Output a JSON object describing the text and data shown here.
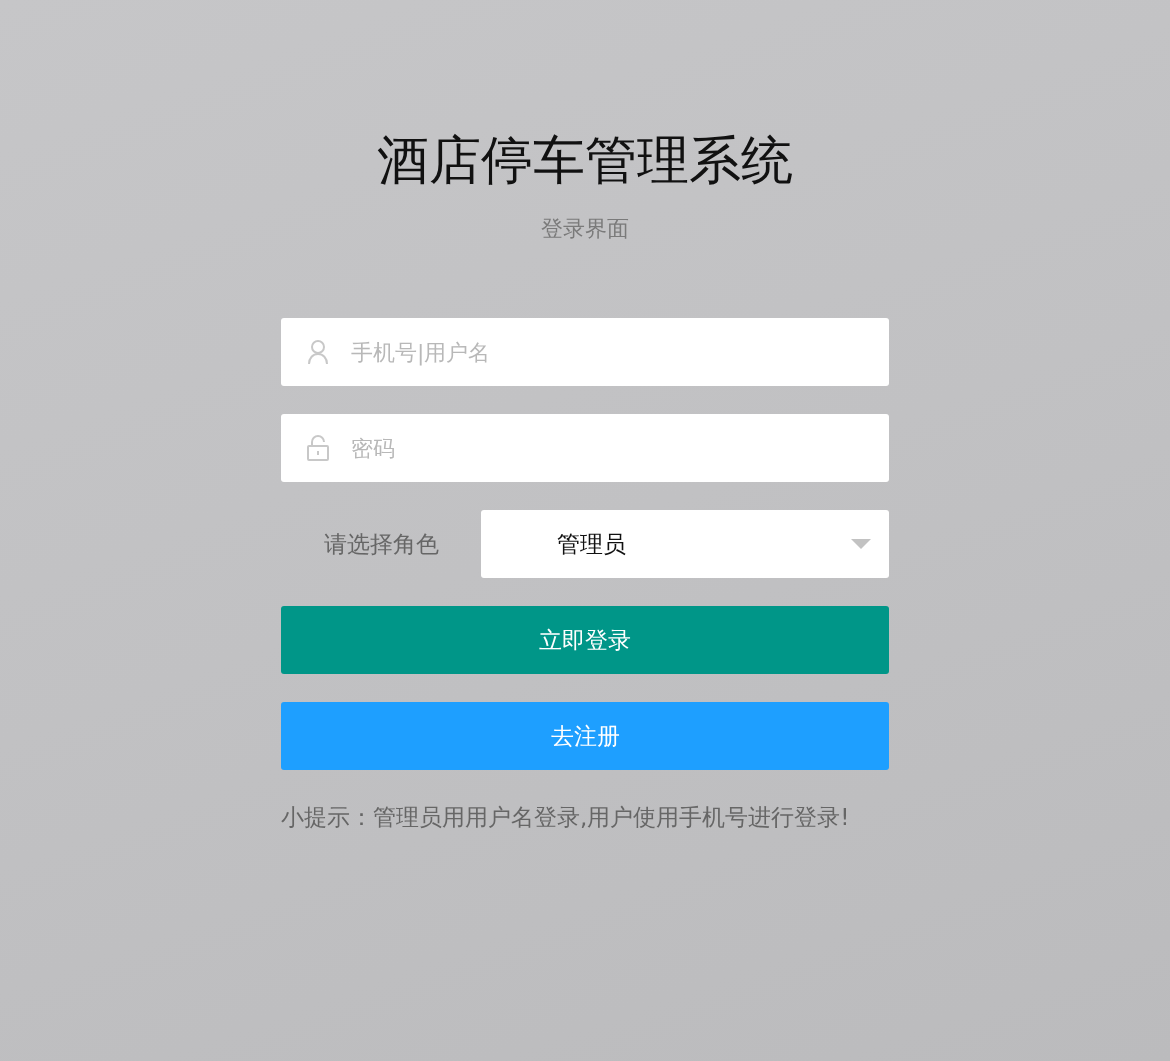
{
  "title": "酒店停车管理系统",
  "subtitle": "登录界面",
  "fields": [
    {
      "kind": "user",
      "placeholder": "手机号|用户名"
    },
    {
      "kind": "password",
      "placeholder": "密码"
    }
  ],
  "role": {
    "label": "请选择角色",
    "value": "管理员"
  },
  "buttons": [
    {
      "label": "立即登录",
      "color": "#009688"
    },
    {
      "label": "去注册",
      "color": "#1e9fff"
    }
  ],
  "hint": "小提示：管理员用用户名登录,用户使用手机号进行登录!"
}
